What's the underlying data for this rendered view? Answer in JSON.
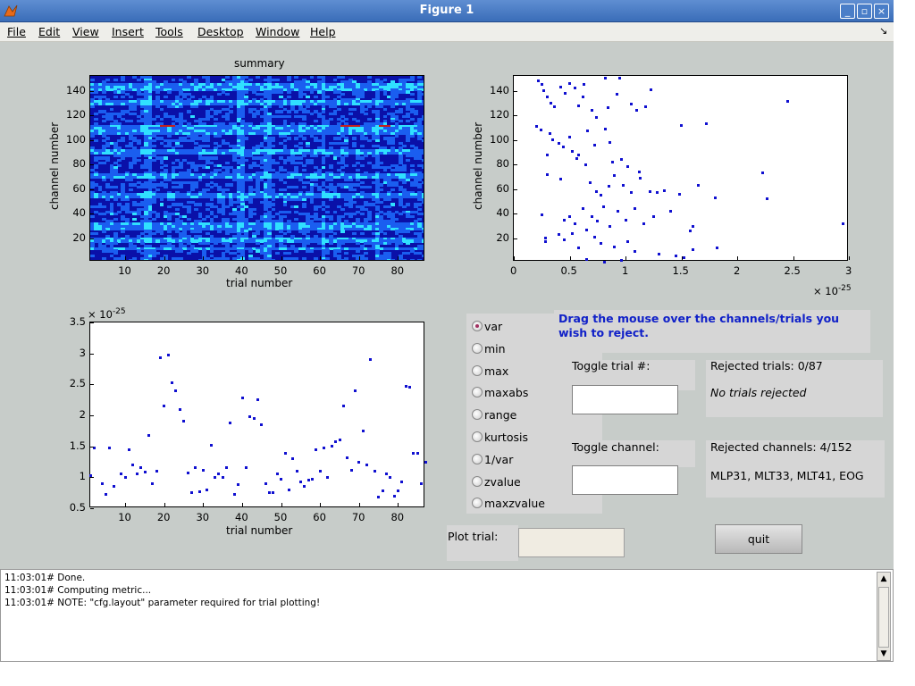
{
  "window": {
    "title": "Figure 1",
    "close": "×",
    "minimize": "_",
    "maximize": "▫"
  },
  "menubar": {
    "items": [
      "File",
      "Edit",
      "View",
      "Insert",
      "Tools",
      "Desktop",
      "Window",
      "Help"
    ],
    "dock_glyph": "↘"
  },
  "heatmap": {
    "title": "summary",
    "xlabel": "trial number",
    "ylabel": "channel number",
    "xticks": [
      "10",
      "20",
      "30",
      "40",
      "50",
      "60",
      "70",
      "80"
    ],
    "yticks": [
      "20",
      "40",
      "60",
      "80",
      "100",
      "120",
      "140"
    ],
    "colors": {
      "low": "#0a10a8",
      "mid": "#1a5ef0",
      "high": "#30e0ff",
      "hot": "#c02020"
    }
  },
  "scatter_channels": {
    "xlabel": "channel number",
    "xticks": [
      "0",
      "0.5",
      "1",
      "1.5",
      "2",
      "2.5",
      "3"
    ],
    "yticks": [
      "20",
      "40",
      "60",
      "80",
      "100",
      "120",
      "140"
    ],
    "exponent": "× 10",
    "exponent_power": "-25"
  },
  "scatter_trials": {
    "xlabel": "trial number",
    "xticks": [
      "10",
      "20",
      "30",
      "40",
      "50",
      "60",
      "70",
      "80"
    ],
    "yticks": [
      "0.5",
      "1",
      "1.5",
      "2",
      "2.5",
      "3",
      "3.5"
    ],
    "exponent": "× 10",
    "exponent_power": "-25"
  },
  "metrics": {
    "options": [
      "var",
      "min",
      "max",
      "maxabs",
      "range",
      "kurtosis",
      "1/var",
      "zvalue",
      "maxzvalue"
    ],
    "selected": "var"
  },
  "instructions": "Drag the mouse over the channels/trials you wish to reject.",
  "toggle_trial": {
    "label": "Toggle trial #:",
    "value": ""
  },
  "toggle_channel": {
    "label": "Toggle channel:",
    "value": ""
  },
  "rejected_trials": {
    "label": "Rejected trials: 0/87",
    "detail": "No trials rejected"
  },
  "rejected_channels": {
    "label": "Rejected channels: 4/152",
    "detail": "MLP31, MLT33, MLT41, EOG"
  },
  "plot_trial": {
    "label": "Plot trial:",
    "value": ""
  },
  "quit_label": "quit",
  "console": {
    "lines": [
      "11:03:01# Done.",
      "11:03:01# Computing metric...",
      "11:03:01# NOTE: \"cfg.layout\" parameter required for trial plotting!"
    ]
  },
  "chart_data": [
    {
      "type": "heatmap",
      "title": "summary",
      "xlabel": "trial number",
      "ylabel": "channel number",
      "xlim": [
        1,
        87
      ],
      "ylim": [
        1,
        152
      ]
    },
    {
      "type": "scatter",
      "title": "",
      "xlabel": "",
      "ylabel": "channel number",
      "xlim": [
        0,
        3e-25
      ],
      "ylim": [
        1,
        152
      ],
      "points": [
        [
          2.2e-26,
          148
        ],
        [
          2.5e-26,
          145
        ],
        [
          2.7e-26,
          140
        ],
        [
          3e-26,
          135
        ],
        [
          3.3e-26,
          130
        ],
        [
          3.6e-26,
          127
        ],
        [
          4.2e-26,
          143
        ],
        [
          4.6e-26,
          138
        ],
        [
          5e-26,
          146
        ],
        [
          5.5e-26,
          142
        ],
        [
          6.3e-26,
          145
        ],
        [
          8.2e-26,
          150
        ],
        [
          9.5e-26,
          150
        ],
        [
          6.2e-26,
          135
        ],
        [
          5.8e-26,
          128
        ],
        [
          7e-26,
          124
        ],
        [
          7.4e-26,
          118
        ],
        [
          8.4e-26,
          126
        ],
        [
          9.2e-26,
          137
        ],
        [
          1.05e-25,
          129
        ],
        [
          1.1e-25,
          124
        ],
        [
          1.18e-25,
          127
        ],
        [
          1.23e-25,
          141
        ],
        [
          2.45e-25,
          131
        ],
        [
          2e-26,
          111
        ],
        [
          2.4e-26,
          108
        ],
        [
          3.2e-26,
          105
        ],
        [
          3.5e-26,
          100
        ],
        [
          4e-26,
          97
        ],
        [
          4.4e-26,
          94
        ],
        [
          5e-26,
          102
        ],
        [
          5.2e-26,
          91
        ],
        [
          5.8e-26,
          88
        ],
        [
          6.6e-26,
          107
        ],
        [
          7.2e-26,
          96
        ],
        [
          8.2e-26,
          109
        ],
        [
          8.6e-26,
          98
        ],
        [
          8.8e-26,
          82
        ],
        [
          9.6e-26,
          84
        ],
        [
          1.02e-25,
          78
        ],
        [
          1.12e-25,
          74
        ],
        [
          1.5e-25,
          112
        ],
        [
          1.72e-25,
          113
        ],
        [
          3e-26,
          88
        ],
        [
          3e-26,
          72
        ],
        [
          4.2e-26,
          68
        ],
        [
          5.6e-26,
          85
        ],
        [
          6.4e-26,
          80
        ],
        [
          6.8e-26,
          65
        ],
        [
          7.4e-26,
          58
        ],
        [
          7.8e-26,
          55
        ],
        [
          8.5e-26,
          62
        ],
        [
          9e-26,
          71
        ],
        [
          9.8e-26,
          63
        ],
        [
          1.05e-25,
          57
        ],
        [
          1.13e-25,
          69
        ],
        [
          1.22e-25,
          58
        ],
        [
          1.28e-25,
          57
        ],
        [
          1.35e-25,
          59
        ],
        [
          1.48e-25,
          56
        ],
        [
          1.65e-25,
          63
        ],
        [
          1.8e-25,
          53
        ],
        [
          2.23e-25,
          73
        ],
        [
          2.27e-25,
          52
        ],
        [
          2.5e-26,
          39
        ],
        [
          4.5e-26,
          35
        ],
        [
          5e-26,
          38
        ],
        [
          5.5e-26,
          32
        ],
        [
          6.2e-26,
          44
        ],
        [
          7e-26,
          38
        ],
        [
          7.5e-26,
          34
        ],
        [
          8e-26,
          46
        ],
        [
          8.6e-26,
          30
        ],
        [
          9.3e-26,
          42
        ],
        [
          1e-25,
          35
        ],
        [
          1.08e-25,
          44
        ],
        [
          1.16e-25,
          32
        ],
        [
          1.25e-25,
          38
        ],
        [
          1.4e-25,
          42
        ],
        [
          1.58e-25,
          26
        ],
        [
          1.6e-25,
          30
        ],
        [
          2.95e-25,
          32
        ],
        [
          2.8e-26,
          20
        ],
        [
          2.8e-26,
          17
        ],
        [
          4e-26,
          23
        ],
        [
          4.5e-26,
          19
        ],
        [
          5.2e-26,
          24
        ],
        [
          5.8e-26,
          12
        ],
        [
          6.5e-26,
          27
        ],
        [
          7.2e-26,
          21
        ],
        [
          7.8e-26,
          16
        ],
        [
          9e-26,
          13
        ],
        [
          1.02e-25,
          17
        ],
        [
          1.08e-25,
          9
        ],
        [
          1.3e-25,
          7
        ],
        [
          1.45e-25,
          6
        ],
        [
          1.52e-25,
          4
        ],
        [
          1.6e-25,
          11
        ],
        [
          1.82e-25,
          12
        ],
        [
          6.5e-26,
          3
        ],
        [
          8.1e-26,
          1
        ],
        [
          9.6e-26,
          2
        ]
      ]
    },
    {
      "type": "scatter",
      "title": "",
      "xlabel": "trial number",
      "ylabel": "",
      "xlim": [
        1,
        87
      ],
      "ylim": [
        5e-26,
        3.5e-25
      ],
      "x": [
        1,
        2,
        4,
        5,
        6,
        7,
        9,
        10,
        11,
        12,
        13,
        14,
        15,
        16,
        17,
        18,
        19,
        20,
        21,
        22,
        23,
        24,
        25,
        26,
        27,
        28,
        29,
        30,
        31,
        32,
        33,
        34,
        35,
        36,
        37,
        38,
        39,
        40,
        41,
        42,
        43,
        44,
        45,
        46,
        47,
        48,
        49,
        50,
        51,
        52,
        53,
        54,
        55,
        56,
        57,
        58,
        59,
        60,
        61,
        62,
        63,
        64,
        65,
        66,
        67,
        68,
        69,
        70,
        71,
        72,
        73,
        74,
        75,
        76,
        77,
        78,
        79,
        80,
        81,
        82,
        83,
        84,
        85,
        86,
        87
      ],
      "y": [
        1.02,
        1.48,
        0.9,
        0.72,
        1.48,
        0.85,
        1.05,
        1.0,
        1.45,
        1.2,
        1.05,
        1.15,
        1.08,
        1.68,
        0.9,
        1.1,
        2.93,
        2.15,
        2.97,
        2.53,
        2.4,
        2.1,
        1.9,
        1.07,
        0.75,
        1.15,
        0.77,
        1.12,
        0.8,
        1.52,
        1.0,
        1.05,
        1.0,
        1.15,
        1.88,
        0.72,
        0.88,
        2.28,
        1.15,
        1.98,
        1.95,
        2.25,
        1.85,
        0.9,
        0.75,
        0.75,
        1.05,
        0.97,
        1.38,
        0.8,
        1.3,
        1.1,
        0.93,
        0.85,
        0.95,
        0.97,
        1.45,
        1.1,
        1.47,
        1.0,
        1.5,
        1.57,
        1.6,
        2.15,
        1.32,
        1.12,
        2.4,
        1.25,
        1.75,
        1.2,
        2.9,
        1.1,
        0.68,
        0.78,
        1.05,
        1.0,
        0.7,
        0.78,
        0.93,
        2.47,
        2.45,
        1.38,
        1.38,
        0.9,
        1.25,
        1.0,
        0.88
      ]
    }
  ]
}
